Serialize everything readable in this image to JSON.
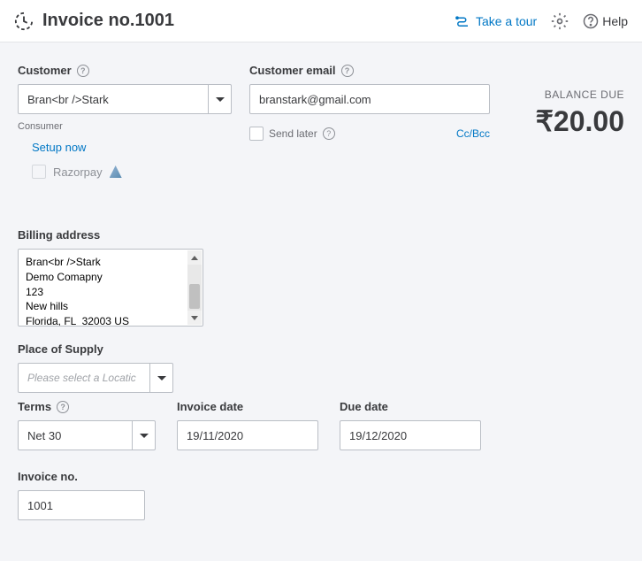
{
  "header": {
    "title": "Invoice no.1001",
    "take_tour": "Take a tour",
    "help": "Help"
  },
  "customer": {
    "label": "Customer",
    "value": "Bran<br />Stark",
    "consumer_label": "Consumer",
    "setup_now": "Setup now",
    "razorpay": "Razorpay"
  },
  "email": {
    "label": "Customer email",
    "value": "branstark@gmail.com",
    "send_later": "Send later",
    "ccbcc": "Cc/Bcc"
  },
  "balance": {
    "label": "BALANCE DUE",
    "amount": "₹20.00"
  },
  "billing": {
    "label": "Billing address",
    "value": "Bran<br />Stark\nDemo Comapny\n123\nNew hills\nFlorida, FL  32003 US"
  },
  "place_of_supply": {
    "label": "Place of Supply",
    "placeholder": "Please select a Locatic"
  },
  "terms": {
    "label": "Terms",
    "value": "Net 30"
  },
  "invoice_date": {
    "label": "Invoice date",
    "value": "19/11/2020"
  },
  "due_date": {
    "label": "Due date",
    "value": "19/12/2020"
  },
  "invoice_no": {
    "label": "Invoice no.",
    "value": "1001"
  }
}
